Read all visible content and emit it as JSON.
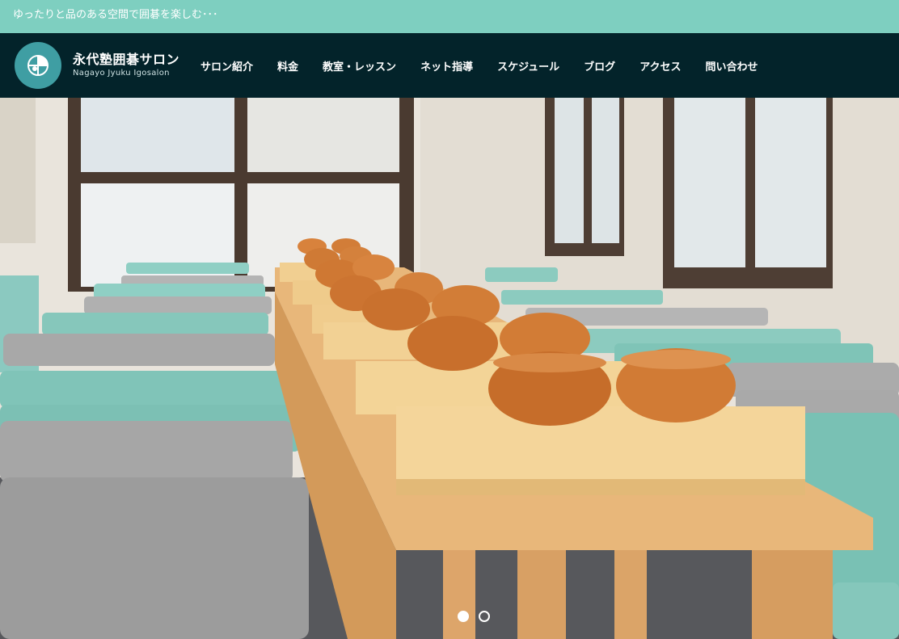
{
  "topbar": {
    "tagline": "ゆったりと品のある空間で囲碁を楽しむ･･･"
  },
  "logo": {
    "title": "永代塾囲碁サロン",
    "subtitle": "Nagayo Jyuku Igosalon",
    "icon": "go-stone-logo-icon"
  },
  "nav": {
    "items": [
      {
        "label": "サロン紹介"
      },
      {
        "label": "料金"
      },
      {
        "label": "教室・レッスン"
      },
      {
        "label": "ネット指導"
      },
      {
        "label": "スケジュール"
      },
      {
        "label": "ブログ"
      },
      {
        "label": "アクセス"
      },
      {
        "label": "問い合わせ"
      }
    ]
  },
  "hero": {
    "slide_count": 2,
    "active_slide": 1
  },
  "colors": {
    "topbar": "#7ecfc0",
    "navbar": "#03232a",
    "logo_circle": "#3f9ea3"
  }
}
